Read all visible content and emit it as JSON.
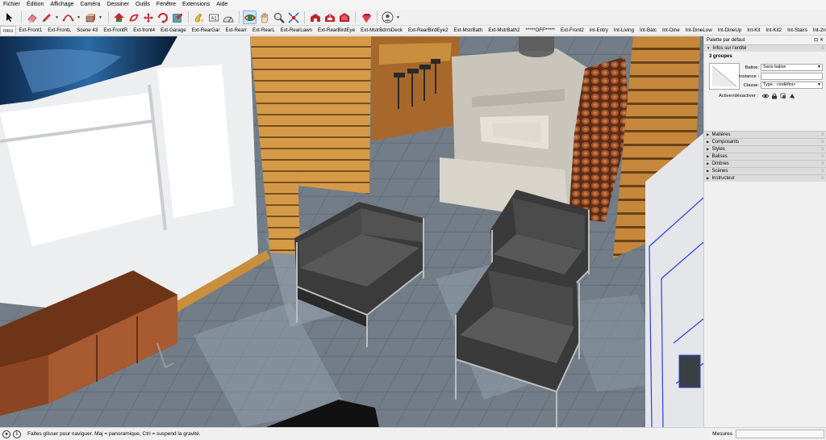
{
  "menu": [
    "Fichier",
    "Édition",
    "Affichage",
    "Caméra",
    "Dessiner",
    "Outils",
    "Fenêtre",
    "Extensions",
    "Aide"
  ],
  "toolbar": {
    "tools": [
      "select-arrow-icon",
      "eraser-icon",
      "pencil-icon",
      "arc-icon",
      "push-pull-icon",
      "move-icon",
      "rotate-icon",
      "scale-icon",
      "offset-icon",
      "tape-measure-icon",
      "text-label-icon",
      "paint-bucket-icon",
      "orbit-icon",
      "hand-pan-icon",
      "zoom-icon",
      "zoom-extents-icon",
      "warehouse-icon",
      "extension-warehouse-icon",
      "layout-icon",
      "ruby-icon",
      "profile-icon"
    ],
    "active_tool": "orbit-icon"
  },
  "scenes": {
    "active": "Intro",
    "tabs": [
      "Intro",
      "Ext-Front1",
      "Ext-FrontL",
      "Scene 43",
      "Ext-FrontR",
      "Ext-front4",
      "Ext-Garage",
      "Ext-RearGar",
      "Ext-Rearr",
      "Ext-RearL",
      "Ext-RearLawn",
      "Ext-RearBirdEye",
      "Ext-MstrBdrmDeck",
      "Ext-RearBirdEye2",
      "Ext-MstrBath",
      "Ext-MstrBath2",
      "*****OFF*****",
      "Ext-Front2",
      "int-Entry",
      "Int-Living",
      "Int-Balc",
      "Int-Dine",
      "Int-DineLow",
      "Int-DineUp",
      "Int-Kit",
      "Int-Kit2",
      "Int-Stairs",
      "Int-2ndhall",
      "Int-Rmeob",
      "Int-stairs"
    ]
  },
  "tray": {
    "title": "Palette par défaut",
    "controls": [
      "pin-icon",
      "close-icon"
    ],
    "entity_panel": {
      "title": "Infos sur l'entité",
      "count": "3 groupes",
      "tag_label": "Balise:",
      "tag_value": "Sans balise",
      "instance_label": "Instance :",
      "instance_value": "",
      "class_label": "Classe:",
      "class_value": "Type : <indéfini>",
      "toggle_label": "Activer/désactiver :"
    },
    "panels": [
      "Matières",
      "Composants",
      "Styles",
      "Balises",
      "Ombres",
      "Scènes",
      "Instructeur"
    ]
  },
  "status": {
    "icons": [
      "info-icon",
      "geo-location-icon"
    ],
    "text": "Faites glisser pour naviguer. Maj = panoramique, Ctrl =  suspend la gravité.",
    "measure_label": "Mesures",
    "measure_value": ""
  },
  "colors": {
    "selection": "#2a3fe0",
    "floor": "#6d7882",
    "wood": "#c28a3e"
  }
}
